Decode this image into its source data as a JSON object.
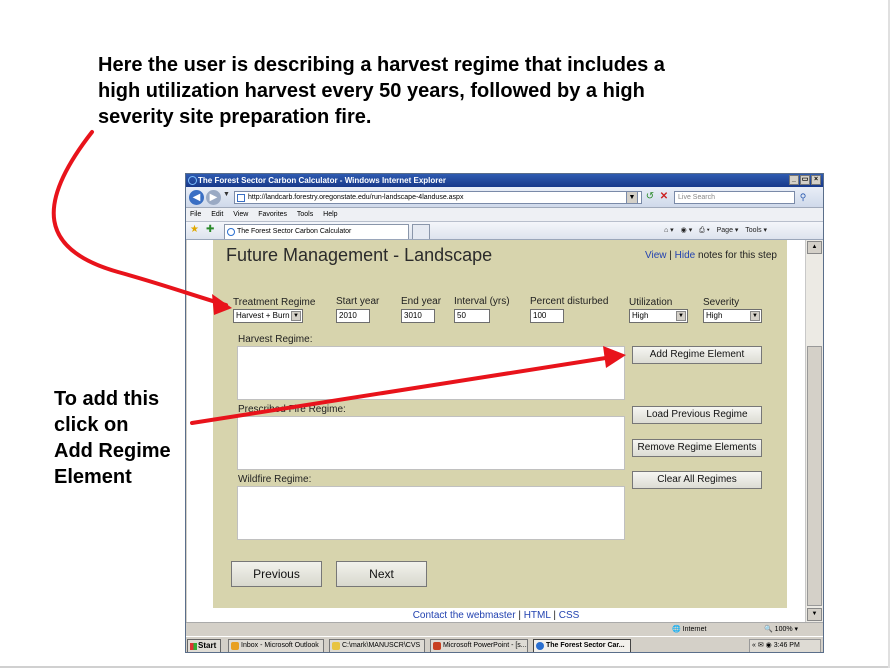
{
  "slide": {
    "caption_top_line1": "Here the user is describing a harvest regime that includes a",
    "caption_top_line2": "high utilization harvest every 50 years, followed by a high",
    "caption_top_line3": "severity site preparation fire.",
    "caption_left_lines": [
      "To add this",
      "click on",
      "Add Regime",
      "Element"
    ],
    "arrow_color": "#e8131b"
  },
  "browser": {
    "title": "The Forest Sector Carbon Calculator - Windows Internet Explorer",
    "window_buttons": [
      "_",
      "×"
    ],
    "url": "http://landcarb.forestry.oregonstate.edu/run-landscape-4landuse.aspx",
    "search_placeholder": "Live Search",
    "menu": [
      "File",
      "Edit",
      "View",
      "Favorites",
      "Tools",
      "Help"
    ],
    "tab_title": "The Forest Sector Carbon Calculator",
    "command_items": [
      "Page ▾",
      "Tools ▾"
    ],
    "status_zone": "Internet",
    "status_zoom": "100%"
  },
  "page": {
    "title": "Future Management - Landscape",
    "notes_view": "View",
    "notes_sep": "|",
    "notes_hide": "Hide",
    "notes_suffix": "notes for this step",
    "labels": {
      "treatment_regime": "Treatment Regime",
      "start_year": "Start year",
      "end_year": "End year",
      "interval": "Interval (yrs)",
      "percent_disturbed": "Percent disturbed",
      "utilization": "Utilization",
      "severity": "Severity"
    },
    "values": {
      "treatment_regime": "Harvest + Burn",
      "start_year": "2010",
      "end_year": "3010",
      "interval": "50",
      "percent_disturbed": "100",
      "utilization": "High",
      "severity": "High"
    },
    "regimes": {
      "harvest": "Harvest Regime:",
      "prescribed_fire": "Prescribed Fire Regime:",
      "wildfire": "Wildfire Regime:"
    },
    "buttons": {
      "add": "Add Regime Element",
      "load": "Load Previous Regime",
      "remove": "Remove Regime Elements",
      "clear": "Clear All Regimes",
      "previous": "Previous",
      "next": "Next"
    },
    "footer": {
      "contact": "Contact the webmaster",
      "sep1": "|",
      "html": "HTML",
      "sep2": "|",
      "css": "CSS"
    }
  },
  "taskbar": {
    "start": "Start",
    "items": [
      {
        "label": "Inbox - Microsoft Outlook",
        "color": "#e8a020"
      },
      {
        "label": "C:\\mark\\MANUSCR\\CVS",
        "color": "#e8c440"
      },
      {
        "label": "Microsoft PowerPoint - [s...",
        "color": "#c84020"
      },
      {
        "label": "The Forest Sector Car...",
        "color": "#2a6fd0"
      }
    ],
    "clock": "3:46 PM"
  }
}
